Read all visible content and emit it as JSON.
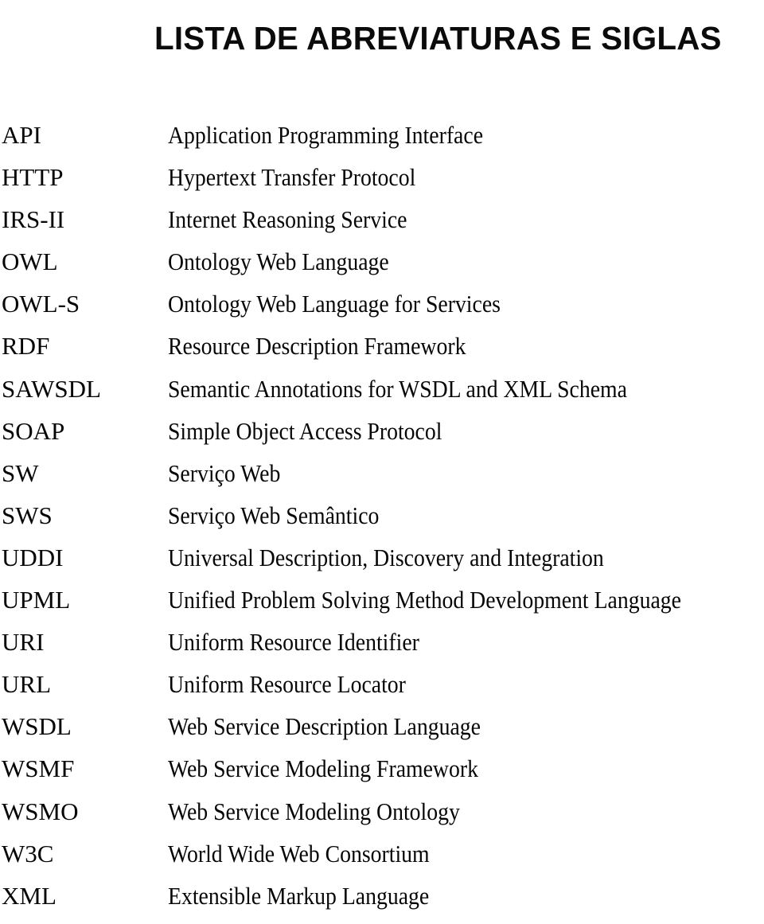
{
  "document": {
    "title": "LISTA DE ABREVIATURAS E SIGLAS",
    "background_color": "#ffffff",
    "text_color": "#000000"
  },
  "abbreviations": [
    {
      "term": "API",
      "definition": "Application Programming Interface"
    },
    {
      "term": "HTTP",
      "definition": "Hypertext Transfer Protocol"
    },
    {
      "term": "IRS-II",
      "definition": "Internet Reasoning Service"
    },
    {
      "term": "OWL",
      "definition": "Ontology Web Language"
    },
    {
      "term": "OWL-S",
      "definition": "Ontology Web Language for Services"
    },
    {
      "term": "RDF",
      "definition": "Resource Description Framework"
    },
    {
      "term": "SAWSDL",
      "definition": "Semantic Annotations for WSDL and XML Schema"
    },
    {
      "term": "SOAP",
      "definition": "Simple Object Access Protocol"
    },
    {
      "term": "SW",
      "definition": "Serviço Web"
    },
    {
      "term": "SWS",
      "definition": "Serviço Web Semântico"
    },
    {
      "term": "UDDI",
      "definition": "Universal Description, Discovery and Integration"
    },
    {
      "term": "UPML",
      "definition": "Unified Problem Solving Method Development Language"
    },
    {
      "term": "URI",
      "definition": "Uniform Resource Identifier"
    },
    {
      "term": "URL",
      "definition": "Uniform Resource Locator"
    },
    {
      "term": "WSDL",
      "definition": "Web Service Description Language"
    },
    {
      "term": "WSMF",
      "definition": "Web Service Modeling Framework"
    },
    {
      "term": "WSMO",
      "definition": "Web Service Modeling Ontology"
    },
    {
      "term": "W3C",
      "definition": "World Wide Web Consortium"
    },
    {
      "term": "XML",
      "definition": "Extensible Markup Language"
    }
  ]
}
